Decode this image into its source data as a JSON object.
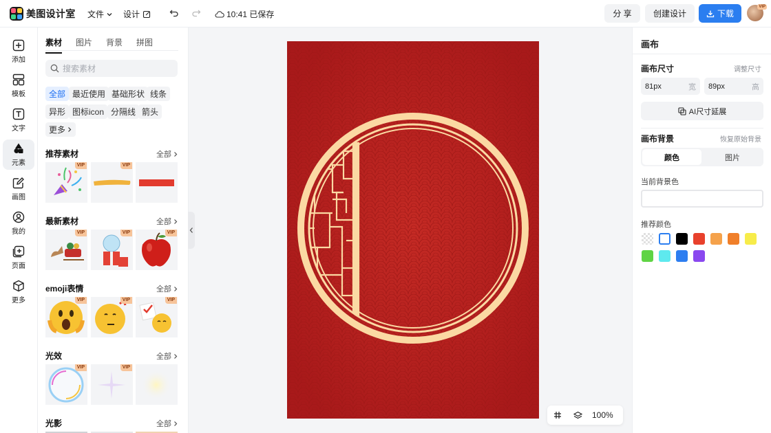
{
  "header": {
    "app_name": "美图设计室",
    "menu_file": "文件",
    "menu_design": "设计",
    "save_status": "10:41 已保存",
    "share_label": "分 享",
    "create_label": "创建设计",
    "download_label": "下载",
    "avatar_badge": "VIP"
  },
  "leftnav": {
    "items": [
      {
        "label": "添加",
        "icon": "plus-square-icon"
      },
      {
        "label": "模板",
        "icon": "layout-icon"
      },
      {
        "label": "文字",
        "icon": "text-icon"
      },
      {
        "label": "元素",
        "icon": "shapes-icon"
      },
      {
        "label": "画图",
        "icon": "draw-icon"
      },
      {
        "label": "我的",
        "icon": "user-icon"
      },
      {
        "label": "页面",
        "icon": "page-add-icon"
      },
      {
        "label": "更多",
        "icon": "cube-icon"
      }
    ]
  },
  "panel": {
    "tabs": [
      "素材",
      "图片",
      "背景",
      "拼图"
    ],
    "search_placeholder": "搜索素材",
    "chips": [
      "全部",
      "最近使用",
      "基础形状",
      "线条",
      "异形",
      "图标icon",
      "分隔线",
      "箭头",
      "更多"
    ],
    "all_label": "全部",
    "vip_label": "VIP",
    "sections": [
      {
        "title": "推荐素材"
      },
      {
        "title": "最新素材"
      },
      {
        "title": "emoji表情"
      },
      {
        "title": "光效"
      },
      {
        "title": "光影"
      }
    ]
  },
  "canvas": {
    "zoom": "100%"
  },
  "rightpanel": {
    "title": "画布",
    "size_label": "画布尺寸",
    "adjust_size": "调整尺寸",
    "width_value": "81px",
    "width_unit": "宽",
    "height_value": "89px",
    "height_unit": "高",
    "ai_extend": "AI尺寸延展",
    "bg_label": "画布背景",
    "restore_bg": "恢复原始背景",
    "bg_tab_color": "颜色",
    "bg_tab_image": "图片",
    "current_bg_label": "当前背景色",
    "recommend_label": "推荐颜色",
    "colors": [
      "transparent",
      "#ffffff",
      "#000000",
      "#e8412c",
      "#f5a24b",
      "#f07f2a",
      "#f7ec4a",
      "#5fd444",
      "#5ee9ee",
      "#2d7ef0",
      "#8a48ef"
    ]
  },
  "colors": {
    "accent": "#2b7ef0",
    "poster_red": "#b11d1b",
    "frame_cream": "#fbd9a3"
  }
}
